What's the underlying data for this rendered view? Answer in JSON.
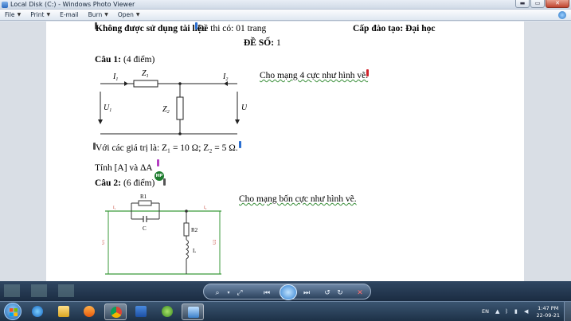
{
  "window": {
    "title": "Local Disk (C:) - Windows Photo Viewer",
    "min_label": "▬",
    "max_label": "▭",
    "close_label": "✕"
  },
  "menu": [
    {
      "label": "File"
    },
    {
      "label": "Print"
    },
    {
      "label": "E-mail"
    },
    {
      "label": "Burn"
    },
    {
      "label": "Open"
    }
  ],
  "document": {
    "header_left": "Không được sử dụng tài liệu",
    "header_mid": "Đề thi có: 01 trang",
    "header_right": "Cấp đào tạo: Đại học",
    "exam_number_label": "ĐỀ SỐ:",
    "exam_number_value": "1",
    "q1_label": "Câu 1:",
    "q1_points": "(4 điểm)",
    "q1_text": "Cho mạng 4 cực như hình vẽ.",
    "q1_values": "Với các giá trị là: Z₁ = 10 Ω; Z₂ = 5 Ω.",
    "q1_task": "Tính [A] và ∆A",
    "q2_label": "Câu 2:",
    "q2_points": "(6 điểm)",
    "q2_text": "Cho mạng bốn cực như hình vẽ.",
    "hp_badge": "HP"
  },
  "circuit1": {
    "I1": "I",
    "I1_sub": "1",
    "I2": "I",
    "I2_sub": "2",
    "Z1": "Z",
    "Z1_sub": "1",
    "Z2": "Z",
    "Z2_sub": "2",
    "U1": "U",
    "U1_sub": "1",
    "U2": "U",
    "U2_sub": "2"
  },
  "circuit2": {
    "R1": "R1",
    "C": "C",
    "R2": "R2",
    "L": "L",
    "I1": "I₁",
    "I2": "I₂",
    "U1": "U1",
    "U2": "U2"
  },
  "taskbar": {
    "language": "EN",
    "time": "1:47 PM",
    "date": "22-09-21"
  },
  "colors": {
    "taskbar": "#1d3147",
    "circuit2_wire": "#3a9a3a",
    "circuit2_labels": "#c0392b",
    "comment_blue": "#2b6fd1",
    "comment_red": "#d0232b",
    "comment_purple": "#b43fc2",
    "hp_badge": "#1e7d2f"
  }
}
